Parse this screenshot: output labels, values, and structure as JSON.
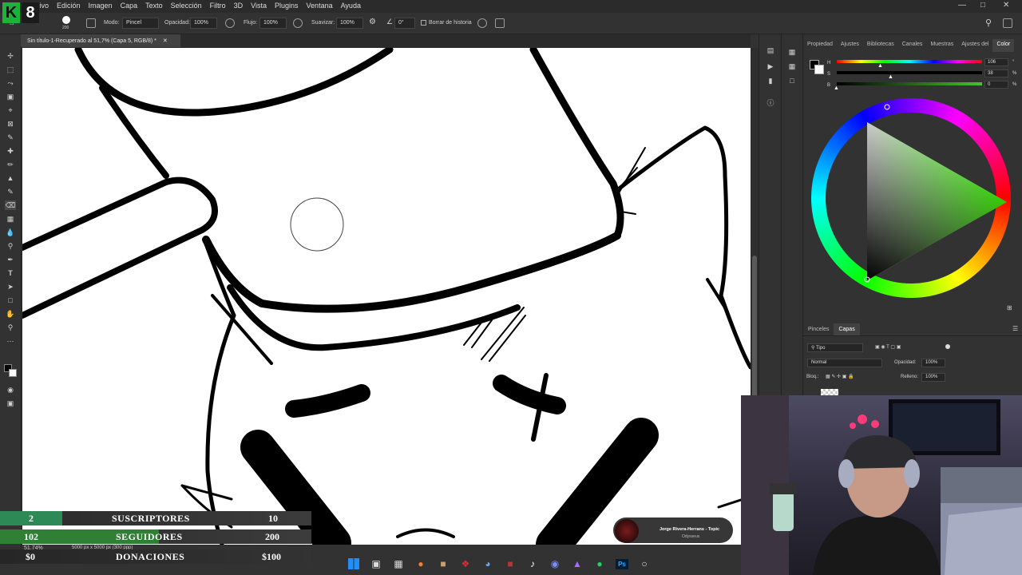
{
  "menubar": {
    "items": [
      "Archivo",
      "Edición",
      "Imagen",
      "Capa",
      "Texto",
      "Selección",
      "Filtro",
      "3D",
      "Vista",
      "Plugins",
      "Ventana",
      "Ayuda"
    ],
    "logo_letter": "K",
    "logo_number": "8"
  },
  "options": {
    "brush_size": "200",
    "mode_label": "Modo:",
    "mode_value": "Pincel",
    "opacity_label": "Opacidad:",
    "opacity_value": "100%",
    "flow_label": "Flujo:",
    "flow_value": "100%",
    "smoothing_label": "Suavizar:",
    "smoothing_value": "100%",
    "angle_value": "0°",
    "history_label": "Borrar de historia"
  },
  "document": {
    "tab_title": "Sin título-1-Recuperado al 51,7% (Capa 5, RGB/8) *",
    "zoom": "51,74%",
    "dimensions": "5000 px x 5000 px (300 ppp)"
  },
  "panel": {
    "tabs": [
      "Propiedad",
      "Ajustes",
      "Bibliotecas",
      "Canales",
      "Muestras",
      "Ajustes del",
      "Color"
    ],
    "h_label": "H",
    "s_label": "S",
    "b_label": "B",
    "h_value": "106",
    "s_value": "38",
    "b_value": "0",
    "pct": "%",
    "deg": "°",
    "colors": {
      "wheel_triangle": "#3bff00"
    }
  },
  "layers": {
    "tabs": [
      "Pinceles",
      "Capas"
    ],
    "filter_label": "Tipo",
    "blend_mode": "Normal",
    "opacity_label": "Opacidad:",
    "opacity_value": "100%",
    "lock_label": "Bloq.:",
    "fill_label": "Relleno:",
    "fill_value": "100%"
  },
  "counters": {
    "subs": {
      "current": "2",
      "label": "SUSCRIPTORES",
      "goal": "10",
      "progress": 0.2
    },
    "followers": {
      "current": "102",
      "label": "SEGUIDORES",
      "goal": "200",
      "progress": 0.51
    },
    "donations": {
      "current": "$0",
      "label": "DONACIONES",
      "goal": "$100",
      "progress": 0
    }
  },
  "music": {
    "track": "Jorge Rivera-Herrans - Topic",
    "album": "Odysseus"
  },
  "taskbar": {
    "icons": [
      "windows-icon",
      "files-icon",
      "store-icon",
      "firefox-icon",
      "game-icon",
      "red-icon",
      "steam-icon",
      "app-icon",
      "tiktok-icon",
      "discord-icon",
      "stream-icon",
      "spotify-icon",
      "photoshop-icon",
      "obs-icon"
    ],
    "ps_label": "Ps"
  },
  "toolbar": {
    "tools": [
      "move",
      "marquee",
      "lasso",
      "object-select",
      "crop",
      "frame",
      "eyedropper",
      "healing",
      "brush",
      "stamp",
      "history-brush",
      "eraser",
      "gradient",
      "blur",
      "dodge",
      "pen",
      "type",
      "path-select",
      "shape",
      "hand",
      "zoom",
      "more"
    ]
  }
}
